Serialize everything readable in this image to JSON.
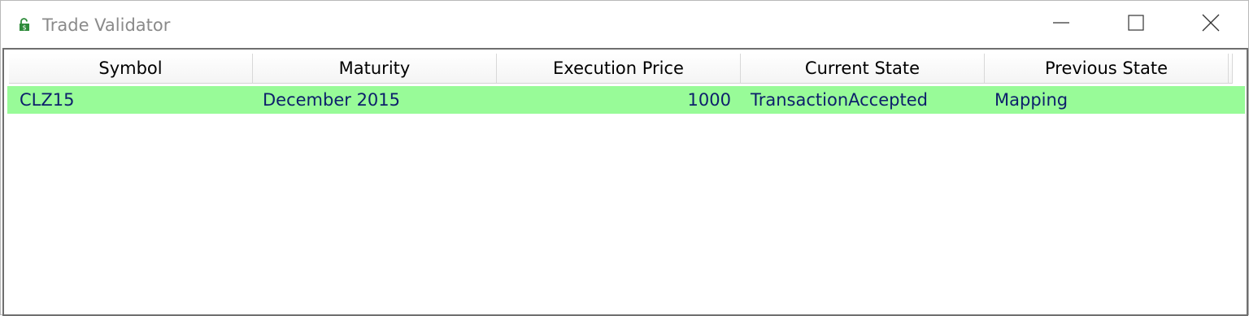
{
  "window": {
    "title": "Trade Validator",
    "icon": "lock-dollar-icon"
  },
  "caption_buttons": [
    "minimize-icon",
    "maximize-icon",
    "close-icon"
  ],
  "grid": {
    "columns": [
      "Symbol",
      "Maturity",
      "Execution Price",
      "Current State",
      "Previous State"
    ],
    "rows": [
      {
        "symbol": "CLZ15",
        "maturity": "December 2015",
        "execution_price": "1000",
        "current_state": "TransactionAccepted",
        "previous_state": "Mapping",
        "row_color": "#98fb98"
      }
    ]
  },
  "colors": {
    "title_text": "#8a8a8a",
    "row_highlight": "#98fb98",
    "cell_text": "#0d1f6b",
    "icon_green": "#2e8b3a"
  }
}
